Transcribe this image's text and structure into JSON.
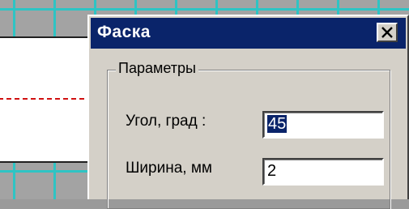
{
  "dialog": {
    "title": "Фаска",
    "close_icon": "close-x-icon",
    "group_title": "Параметры",
    "angle": {
      "label": "Угол, град :",
      "value": "45"
    },
    "width": {
      "label": "Ширина, мм",
      "value": "2"
    }
  },
  "colors": {
    "titlebar": "#0a246a",
    "dialog_face": "#d4d0c8",
    "grid_line": "#2ec4c4",
    "center_line": "#d01010"
  }
}
